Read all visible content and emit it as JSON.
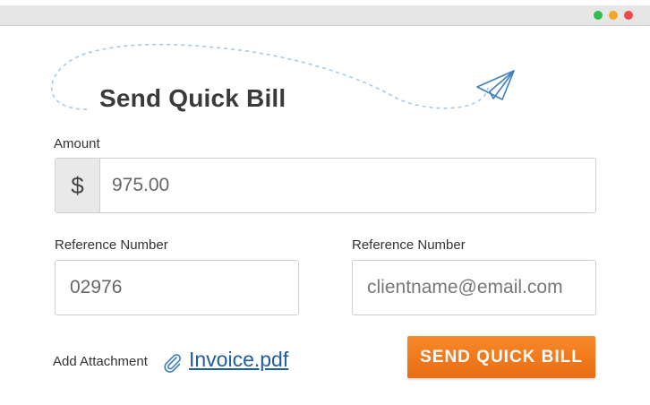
{
  "window": {
    "controls": [
      "minimize",
      "zoom",
      "close"
    ]
  },
  "form": {
    "title": "Send Quick Bill",
    "amount": {
      "label": "Amount",
      "currency_symbol": "$",
      "value": "975.00"
    },
    "reference_left": {
      "label": "Reference Number",
      "value": "02976"
    },
    "reference_right": {
      "label": "Reference Number",
      "placeholder": "clientname@email.com"
    },
    "attachment": {
      "label": "Add Attachment",
      "icon": "paperclip-icon",
      "file_name": "Invoice.pdf"
    },
    "submit_label": "SEND QUICK BILL"
  },
  "colors": {
    "accent": "#f07d1e",
    "link": "#1f5d9e",
    "decor_line": "#9cc8ea",
    "window_green": "#2fbf4f",
    "window_yellow": "#f5a623",
    "window_red": "#ef4a4a"
  }
}
